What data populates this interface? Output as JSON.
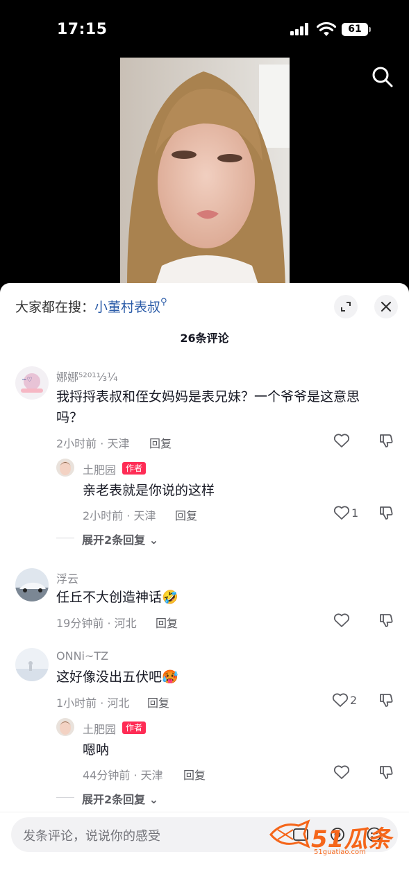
{
  "status_bar": {
    "time": "17:15",
    "battery": "61"
  },
  "header": {
    "hot_search_prefix": "大家都在搜：",
    "hot_search_keyword": "小董村表叔",
    "comment_count": "26条评论"
  },
  "comments": [
    {
      "username": "娜娜⁵²⁰¹⅓¼",
      "text_line1": "我捋捋表叔和侄女妈妈是表兄妹？一个爷爷是这意思",
      "text_line2": "吗？",
      "meta": "2小时前 · 天津",
      "reply_label": "回复",
      "likes": "",
      "sub_reply": {
        "username": "土肥园",
        "author_badge": "作者",
        "text": "亲老表就是你说的这样",
        "meta": "2小时前 · 天津",
        "reply_label": "回复",
        "likes": "1"
      },
      "expand": "展开2条回复"
    },
    {
      "username": "浮云",
      "text": "任丘不大创造神话🤣",
      "meta": "19分钟前 · 河北",
      "reply_label": "回复",
      "likes": ""
    },
    {
      "username": "ONNi~TZ",
      "text": "这好像没出五伏吧🥵",
      "meta": "1小时前 · 河北",
      "reply_label": "回复",
      "likes": "2",
      "sub_reply": {
        "username": "土肥园",
        "author_badge": "作者",
        "text": "嗯呐",
        "meta": "44分钟前 · 天津",
        "reply_label": "回复",
        "likes": ""
      },
      "expand": "展开2条回复"
    }
  ],
  "input_bar": {
    "placeholder": "发条评论，说说你的感受"
  },
  "watermark": {
    "text": "51瓜条",
    "url": "51guatiao.com"
  },
  "colors": {
    "author_badge": "#fe2c55",
    "keyword": "#2a5ba8",
    "watermark": "#f5661a"
  }
}
